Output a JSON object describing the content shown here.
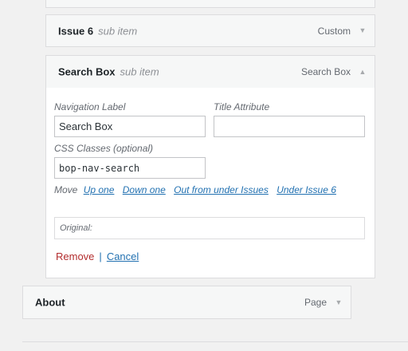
{
  "menu_items": {
    "issue6": {
      "title": "Issue 6",
      "subtitle": "sub item",
      "type": "Custom",
      "toggle_icon": "triangle-down"
    },
    "search_box": {
      "title": "Search Box",
      "subtitle": "sub item",
      "type": "Search Box",
      "toggle_icon": "triangle-up"
    },
    "about": {
      "title": "About",
      "type": "Page",
      "toggle_icon": "triangle-down"
    }
  },
  "settings": {
    "nav_label": {
      "label": "Navigation Label",
      "value": "Search Box"
    },
    "title_attr": {
      "label": "Title Attribute",
      "value": ""
    },
    "css_classes": {
      "label": "CSS Classes (optional)",
      "value": "bop-nav-search"
    },
    "move": {
      "label": "Move",
      "links": [
        "Up one",
        "Down one",
        "Out from under Issues",
        "Under Issue 6"
      ]
    },
    "original": {
      "label": "Original:"
    },
    "actions": {
      "remove": "Remove",
      "separator": "|",
      "cancel": "Cancel"
    }
  },
  "colors": {
    "background": "#f1f1f1",
    "bar": "#f6f7f7",
    "border": "#dcdcde",
    "link": "#2271b1",
    "remove": "#b32d2e"
  }
}
